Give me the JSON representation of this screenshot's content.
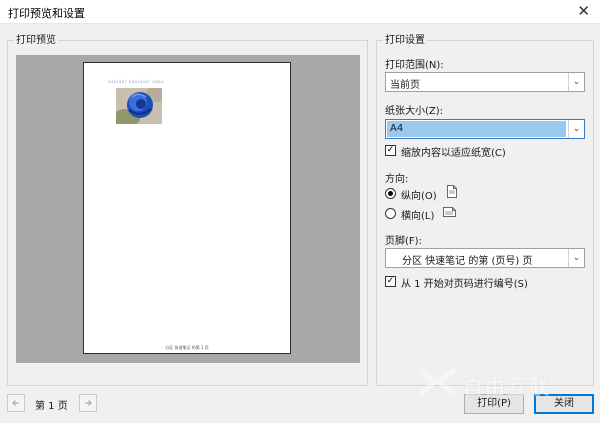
{
  "window": {
    "title": "打印预览和设置",
    "close_glyph": "✕"
  },
  "preview": {
    "group_title": "打印预览",
    "page_header_text": "aaa(aa) aaa(aaa)  aaaa",
    "page_footer_text": "分区  快速笔记  的第 1 页"
  },
  "settings": {
    "group_title": "打印设置",
    "print_range": {
      "label": "打印范围(N):",
      "value": "当前页"
    },
    "paper_size": {
      "label": "纸张大小(Z):",
      "value": "A4"
    },
    "fit_width": {
      "label": "缩放内容以适应纸宽(C)",
      "checked": true
    },
    "orientation": {
      "label": "方向:",
      "portrait": {
        "label": "纵向(O)",
        "selected": true,
        "icon": "portrait-page-icon"
      },
      "landscape": {
        "label": "横向(L)",
        "selected": false,
        "icon": "landscape-page-icon"
      }
    },
    "footer": {
      "label": "页脚(F):",
      "value": "分区 快速笔记 的第 (页号) 页"
    },
    "start_numbering": {
      "label": "从 1 开始对页码进行编号(S)",
      "checked": true
    }
  },
  "navigation": {
    "prev_icon": "arrow-left-icon",
    "next_icon": "arrow-right-icon",
    "page_label": "第 1 页"
  },
  "buttons": {
    "print": "打印(P)",
    "close": "关闭"
  },
  "watermark": {
    "text": "自由互联"
  },
  "colors": {
    "accent": "#0078d7",
    "selection": "#99c9ef",
    "preview_bg": "#a8a8a8"
  }
}
